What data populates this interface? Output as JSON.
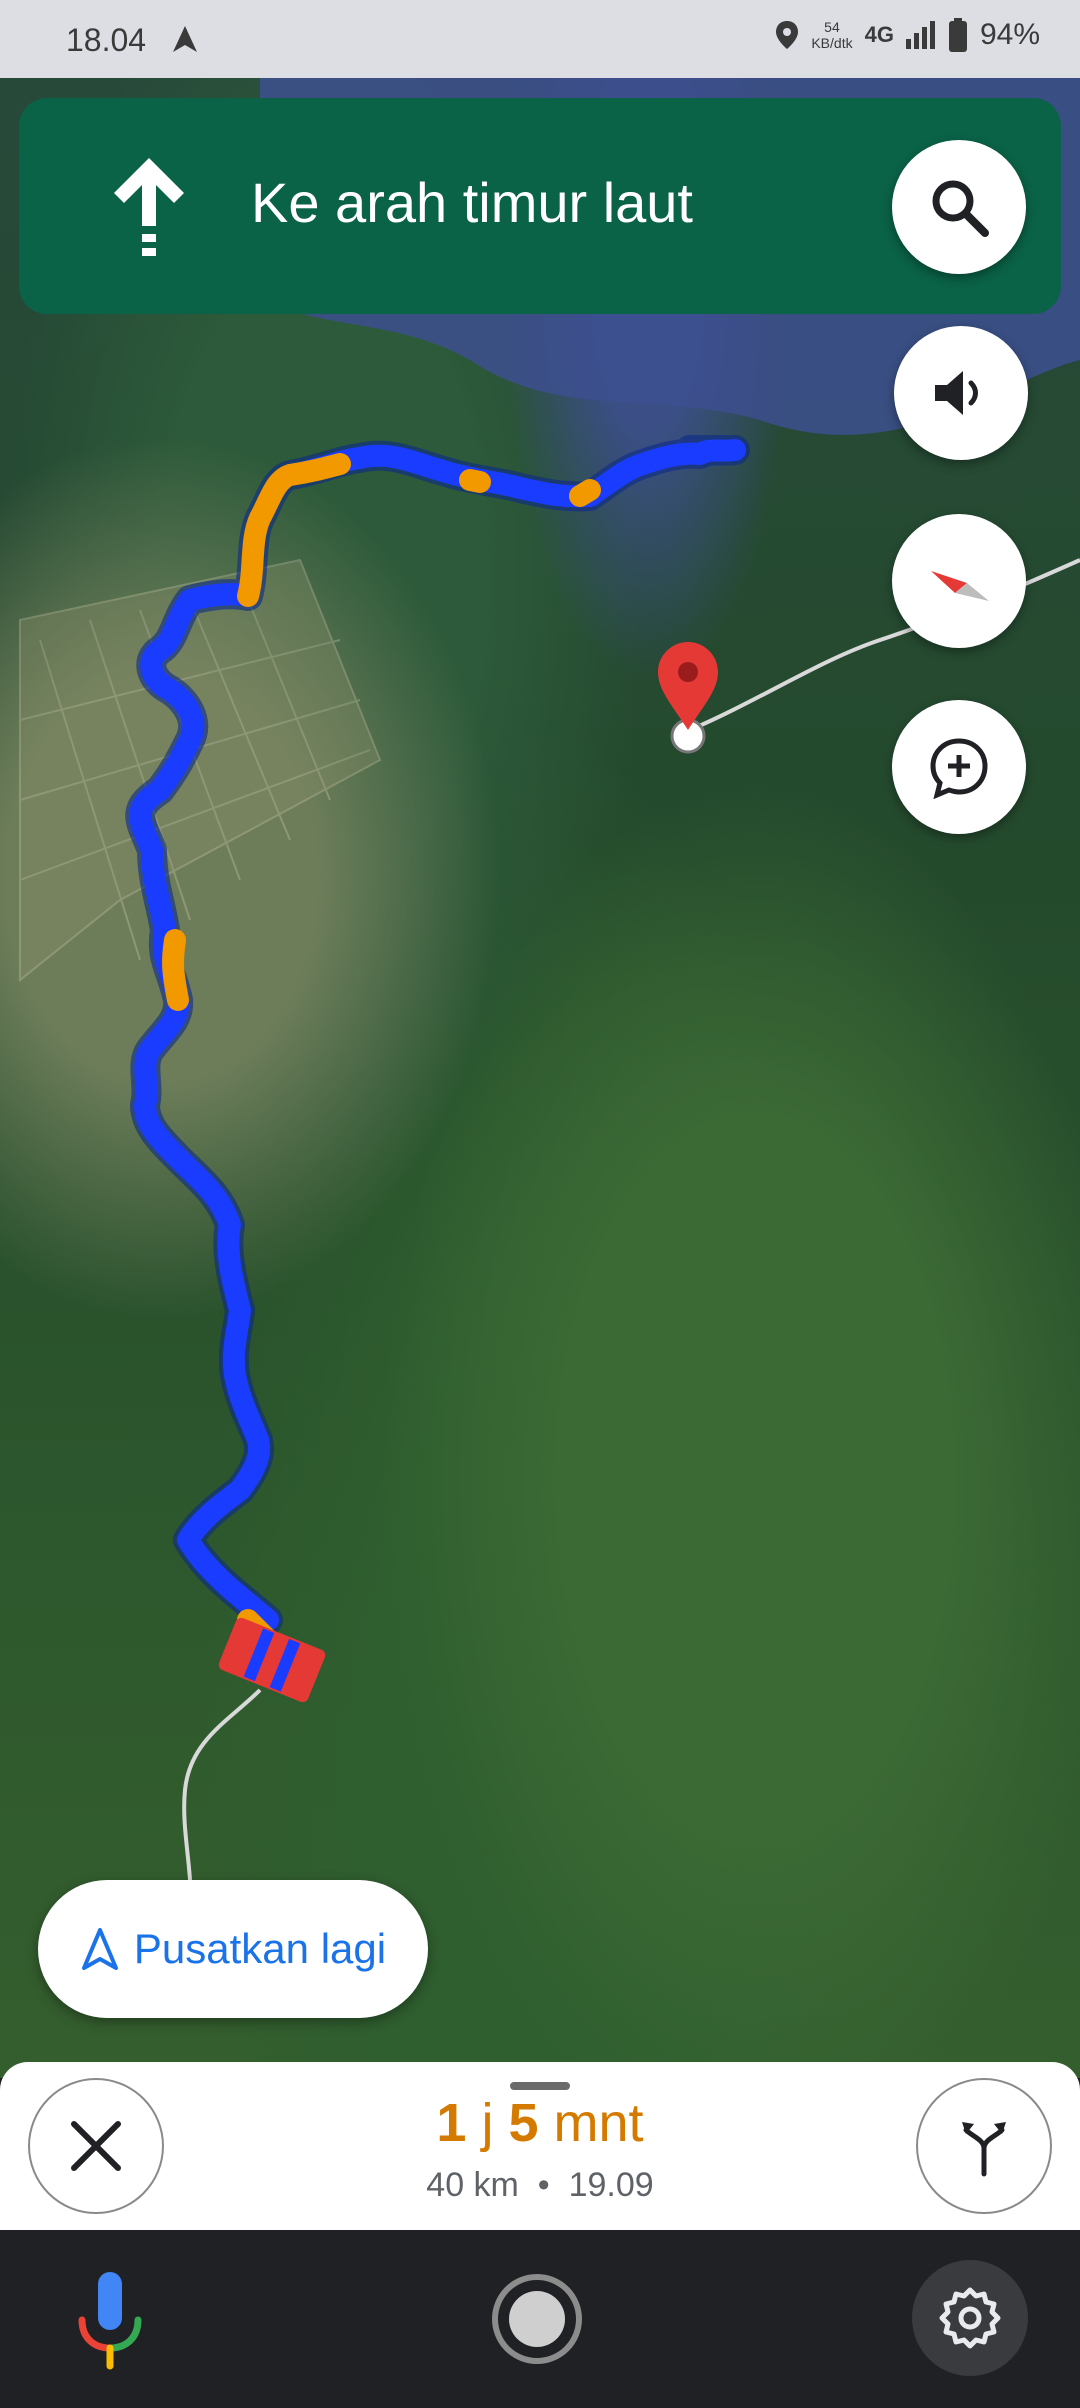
{
  "status_bar": {
    "time": "18.04",
    "net_speed_value": "54",
    "net_speed_unit": "KB/dtk",
    "network": "4G",
    "battery": "94%"
  },
  "banner": {
    "direction_text": "Ke arah timur laut",
    "direction_icon": "straight-arrow-icon"
  },
  "map_buttons": [
    "search-icon",
    "volume-icon",
    "compass-icon",
    "add-comment-icon"
  ],
  "recenter": {
    "label": "Pusatkan lagi"
  },
  "trip": {
    "eta_hours": "1",
    "eta_hours_unit": "j",
    "eta_minutes": "5",
    "eta_minutes_unit": "mnt",
    "distance": "40 km",
    "separator": "•",
    "arrival": "19.09"
  },
  "colors": {
    "banner": "#0a6247",
    "route": "#1a3cff",
    "traffic": "#f29900",
    "eta": "#d57a00",
    "link": "#1a73e8"
  }
}
